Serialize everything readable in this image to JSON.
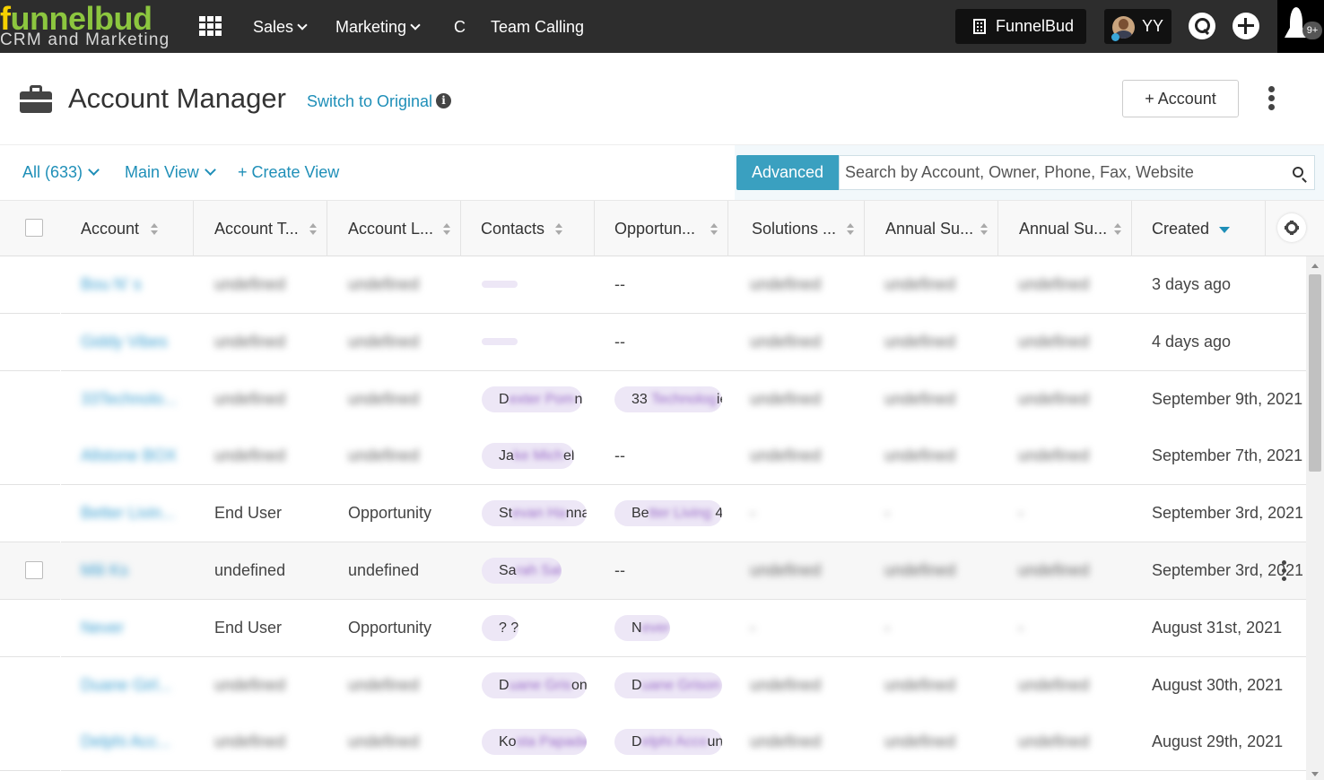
{
  "brand": {
    "name_a": "f",
    "name_b": "unnelbud",
    "tagline": "CRM and Marketing"
  },
  "topnav": {
    "items": [
      {
        "label": "Sales",
        "has_menu": true
      },
      {
        "label": "Marketing",
        "has_menu": true
      },
      {
        "label": "C",
        "has_menu": false
      },
      {
        "label": "Team Calling",
        "has_menu": false
      }
    ],
    "org_label": "FunnelBud",
    "user_initials": "YY",
    "notifications": "9+"
  },
  "page": {
    "title": "Account Manager",
    "switch_label": "Switch to Original",
    "info_glyph": "i",
    "add_label": "+ Account"
  },
  "views": {
    "all_label": "All (633)",
    "main_view_label": "Main View",
    "create_view_label": "+ Create View",
    "advanced_label": "Advanced",
    "search_placeholder": "Search by Account, Owner, Phone, Fax, Website"
  },
  "table": {
    "columns": [
      {
        "label": "Account",
        "sort": "none"
      },
      {
        "label": "Account T...",
        "sort": "none"
      },
      {
        "label": "Account L...",
        "sort": "none"
      },
      {
        "label": "Contacts",
        "sort": "none"
      },
      {
        "label": "Opportun...",
        "sort": "none"
      },
      {
        "label": "Solutions ...",
        "sort": "none"
      },
      {
        "label": "Annual Su...",
        "sort": "none"
      },
      {
        "label": "Annual Su...",
        "sort": "none"
      },
      {
        "label": "Created",
        "sort": "desc"
      }
    ],
    "rows": [
      {
        "account": "Bou N' s",
        "type": "undefined",
        "type_hidden": true,
        "level": "undefined",
        "level_hidden": true,
        "contact": null,
        "contact_empty": true,
        "opportunity": "--",
        "opp_pill": false,
        "solutions": "undefined",
        "annual1": "undefined",
        "annual2": "undefined",
        "created": "3 days ago"
      },
      {
        "account": "Giddy Vibes",
        "type": "undefined",
        "type_hidden": true,
        "level": "undefined",
        "level_hidden": true,
        "contact": null,
        "contact_empty": true,
        "opportunity": "--",
        "opp_pill": false,
        "solutions": "undefined",
        "annual1": "undefined",
        "annual2": "undefined",
        "created": "4 days ago"
      },
      {
        "account": "33Technolo...",
        "type": "undefined",
        "type_hidden": true,
        "level": "undefined",
        "level_hidden": true,
        "contact_visible": "D",
        "contact_hidden": "exter Pom",
        "contact_tail": "n",
        "opp_visible": "33",
        "opp_hidden": " Technolog",
        "opp_tail": "ies",
        "opp_pill": true,
        "solutions": "undefined",
        "annual1": "undefined",
        "annual2": "undefined",
        "created": "September 9th, 2021"
      },
      {
        "account": "Allstone BOX",
        "type": "undefined",
        "type_hidden": true,
        "level": "undefined",
        "level_hidden": true,
        "contact_visible": "Ja",
        "contact_hidden": "ke Mich",
        "contact_tail": "el",
        "opportunity": "--",
        "opp_pill": false,
        "solutions": "undefined",
        "annual1": "undefined",
        "annual2": "undefined",
        "created": "September 7th, 2021"
      },
      {
        "account": "Better Livin...",
        "type": "End User",
        "type_hidden": false,
        "level": "Opportunity",
        "level_hidden": false,
        "contact_visible": "St",
        "contact_hidden": "evan Ha",
        "contact_tail": "nna",
        "opp_visible": "Be",
        "opp_hidden": "tter Living",
        "opp_tail": " 4",
        "opp_pill": true,
        "solutions": "-",
        "annual1": "-",
        "annual2": "-",
        "created": "September 3rd, 2021"
      },
      {
        "account": "Mili Ks",
        "type": "undefined",
        "type_hidden": false,
        "level": "undefined",
        "level_hidden": false,
        "contact_visible": "Sa",
        "contact_hidden": "rah Sal",
        "contact_tail": "",
        "opportunity": "--",
        "opp_pill": false,
        "solutions": "undefined",
        "annual1": "undefined",
        "annual2": "undefined",
        "created": "September 3rd, 2021"
      },
      {
        "account": "Never",
        "type": "End User",
        "type_hidden": false,
        "level": "Opportunity",
        "level_hidden": false,
        "contact_visible": "? ?",
        "contact_hidden": "",
        "contact_tail": "",
        "opp_visible": "N",
        "opp_hidden": "ever",
        "opp_tail": "",
        "opp_pill": true,
        "solutions": "-",
        "annual1": "-",
        "annual2": "-",
        "created": "August 31st, 2021"
      },
      {
        "account": "Duane Girl...",
        "type": "undefined",
        "type_hidden": true,
        "level": "undefined",
        "level_hidden": true,
        "contact_visible": "D",
        "contact_hidden": "uane Gris",
        "contact_tail": "on",
        "opp_visible": "D",
        "opp_hidden": "uane Grison",
        "opp_tail": " -",
        "opp_pill": true,
        "solutions": "undefined",
        "annual1": "undefined",
        "annual2": "undefined",
        "created": "August 30th, 2021"
      },
      {
        "account": "Delphi Acc...",
        "type": "undefined",
        "type_hidden": true,
        "level": "undefined",
        "level_hidden": true,
        "contact_visible": "Ko",
        "contact_hidden": "sta Papadam",
        "contact_tail": "ntzis",
        "opp_visible": "D",
        "opp_hidden": "elphi Acco",
        "opp_tail": "unt",
        "opp_pill": true,
        "solutions": "undefined",
        "annual1": "undefined",
        "annual2": "undefined",
        "created": "August 29th, 2021"
      }
    ]
  }
}
